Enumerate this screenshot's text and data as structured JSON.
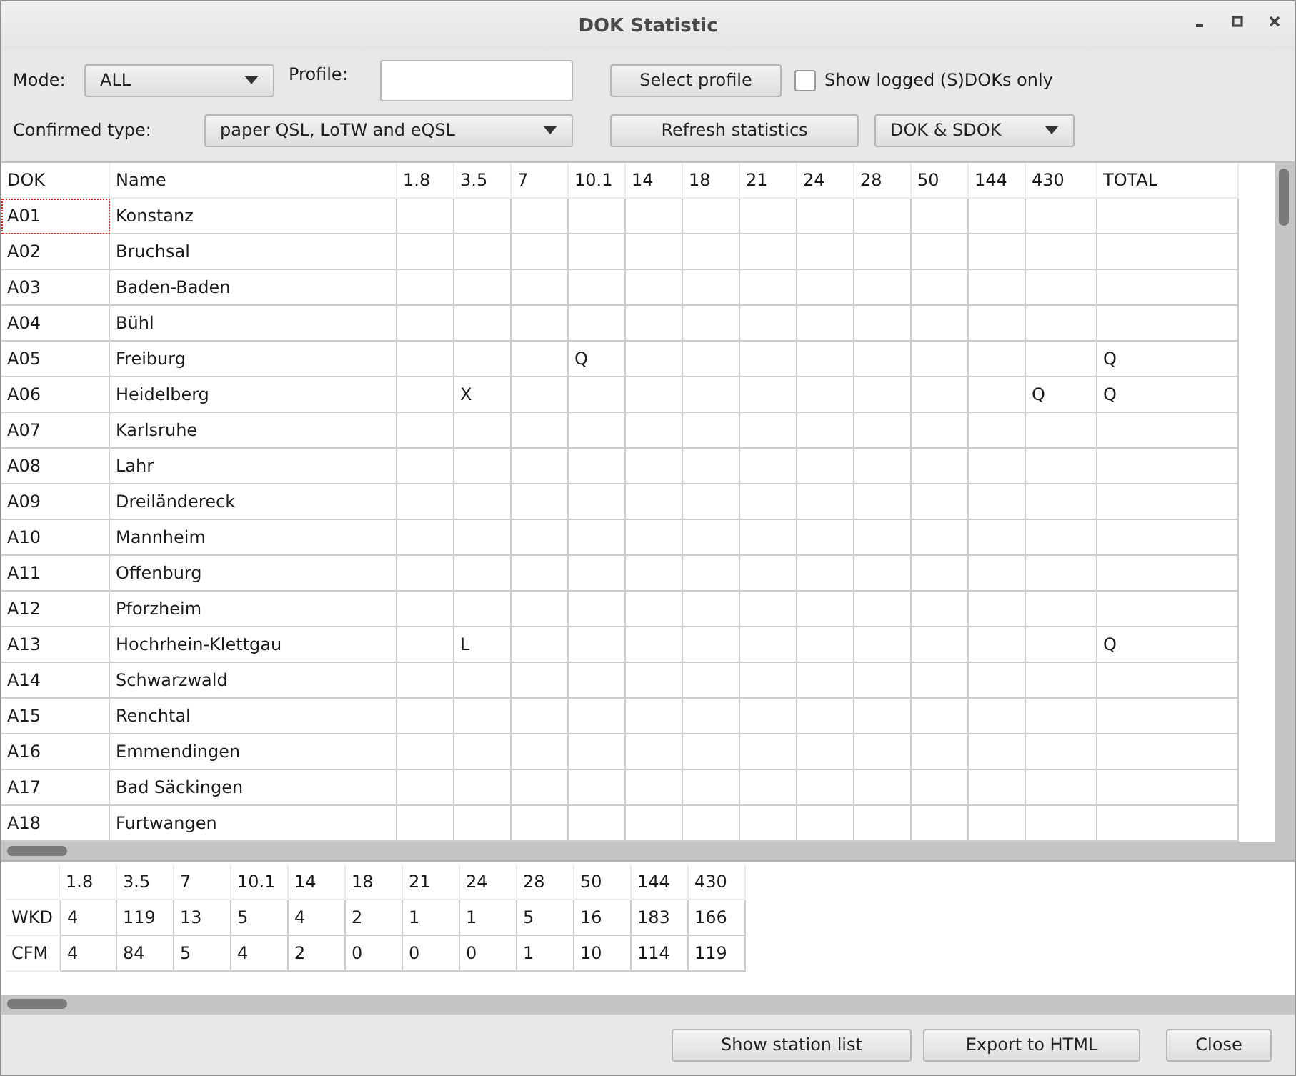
{
  "window": {
    "title": "DOK Statistic"
  },
  "controls": {
    "mode_label": "Mode:",
    "mode": "ALL",
    "profile_label": "Profile:",
    "select_profile": "Select profile",
    "show_logged": {
      "label": "Show logged (S)DOKs only",
      "checked": false
    },
    "confirmed_label": "Confirmed type:",
    "confirmed": "paper QSL, LoTW and eQSL",
    "refresh": "Refresh statistics",
    "dok_type": "DOK & SDOK"
  },
  "table": {
    "columns": [
      "DOK",
      "Name",
      "1.8",
      "3.5",
      "7",
      "10.1",
      "14",
      "18",
      "21",
      "24",
      "28",
      "50",
      "144",
      "430",
      "TOTAL"
    ],
    "rows": [
      {
        "dok": "A01",
        "name": "Konstanz",
        "focused": true
      },
      {
        "dok": "A02",
        "name": "Bruchsal",
        "focused": false
      },
      {
        "dok": "A03",
        "name": "Baden-Baden",
        "focused": false
      },
      {
        "dok": "A04",
        "name": "Bühl",
        "focused": false
      },
      {
        "dok": "A05",
        "name": "Freiburg",
        "focused": false,
        "marks": {
          "10.1": "Q",
          "TOTAL": "Q"
        }
      },
      {
        "dok": "A06",
        "name": "Heidelberg",
        "focused": false,
        "marks": {
          "3.5": "X",
          "430": "Q",
          "TOTAL": "Q"
        }
      },
      {
        "dok": "A07",
        "name": "Karlsruhe",
        "focused": false
      },
      {
        "dok": "A08",
        "name": "Lahr",
        "focused": false
      },
      {
        "dok": "A09",
        "name": "Dreiländereck",
        "focused": false
      },
      {
        "dok": "A10",
        "name": "Mannheim",
        "focused": false
      },
      {
        "dok": "A11",
        "name": "Offenburg",
        "focused": false
      },
      {
        "dok": "A12",
        "name": "Pforzheim",
        "focused": false
      },
      {
        "dok": "A13",
        "name": "Hochrhein-Klettgau",
        "focused": false,
        "marks": {
          "3.5": "L",
          "TOTAL": "Q"
        }
      },
      {
        "dok": "A14",
        "name": "Schwarzwald",
        "focused": false
      },
      {
        "dok": "A15",
        "name": "Renchtal",
        "focused": false
      },
      {
        "dok": "A16",
        "name": "Emmendingen",
        "focused": false
      },
      {
        "dok": "A17",
        "name": "Bad Säckingen",
        "focused": false
      },
      {
        "dok": "A18",
        "name": "Furtwangen",
        "focused": false
      }
    ]
  },
  "summary": {
    "columns": [
      "1.8",
      "3.5",
      "7",
      "10.1",
      "14",
      "18",
      "21",
      "24",
      "28",
      "50",
      "144",
      "430"
    ],
    "rows": [
      {
        "label": "WKD",
        "values": [
          "4",
          "119",
          "13",
          "5",
          "4",
          "2",
          "1",
          "1",
          "5",
          "16",
          "183",
          "166"
        ]
      },
      {
        "label": "CFM",
        "values": [
          "4",
          "84",
          "5",
          "4",
          "2",
          "0",
          "0",
          "0",
          "1",
          "10",
          "114",
          "119"
        ]
      }
    ]
  },
  "buttons": [
    "Show station list",
    "Export to HTML",
    "Close"
  ]
}
